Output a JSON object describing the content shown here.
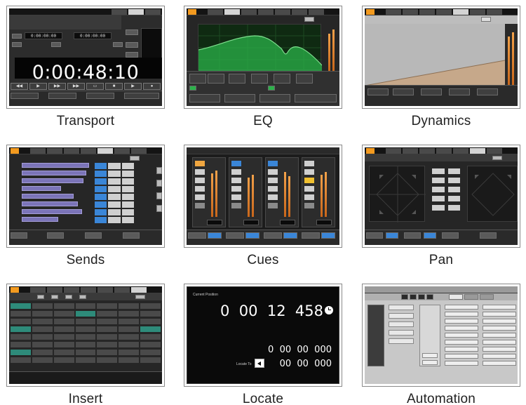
{
  "tiles": [
    {
      "caption": "Transport"
    },
    {
      "caption": "EQ"
    },
    {
      "caption": "Dynamics"
    },
    {
      "caption": "Sends"
    },
    {
      "caption": "Cues"
    },
    {
      "caption": "Pan"
    },
    {
      "caption": "Insert"
    },
    {
      "caption": "Locate"
    },
    {
      "caption": "Automation"
    }
  ],
  "transport": {
    "time": "0:00:48:10",
    "small_time_a": "0:00:00:00",
    "small_time_b": "0:00:00:00",
    "buttons": [
      "◀◀",
      "▶",
      "▶▶",
      "■",
      "●",
      "◀",
      "▶",
      "●"
    ]
  },
  "locate": {
    "current_label": "Current Position",
    "current_time": "0  00  12  458",
    "locate_to_label": "Locate To",
    "row_a": "0  00  00  000",
    "row_b": "00  00  000",
    "clock_icon": "clock-icon"
  },
  "colors": {
    "accent_orange": "#f39a1f",
    "eq_green": "#2bb34a",
    "send_purple": "#7b74b8",
    "blue_button": "#3a86d8",
    "teal_insert": "#2e8b7a"
  }
}
